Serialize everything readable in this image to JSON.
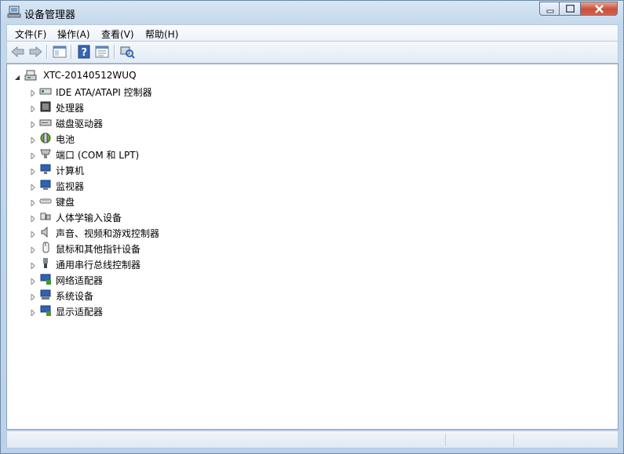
{
  "window": {
    "title": "设备管理器"
  },
  "menu": [
    "文件(F)",
    "操作(A)",
    "查看(V)",
    "帮助(H)"
  ],
  "toolbar": {
    "back_icon": "back-arrow-icon",
    "forward_icon": "forward-arrow-icon",
    "console_tree_icon": "console-tree-icon",
    "help_icon": "help-icon",
    "properties_icon": "properties-icon",
    "scan_icon": "scan-hardware-icon"
  },
  "tree": {
    "root": "XTC-20140512WUQ",
    "items": [
      "IDE ATA/ATAPI 控制器",
      "处理器",
      "磁盘驱动器",
      "电池",
      "端口 (COM 和 LPT)",
      "计算机",
      "监视器",
      "键盘",
      "人体学输入设备",
      "声音、视频和游戏控制器",
      "鼠标和其他指针设备",
      "通用串行总线控制器",
      "网络适配器",
      "系统设备",
      "显示适配器"
    ]
  },
  "status": {
    "text": ""
  },
  "colors": {
    "close_button": "#c75039",
    "frame": "#bcd2ea"
  }
}
